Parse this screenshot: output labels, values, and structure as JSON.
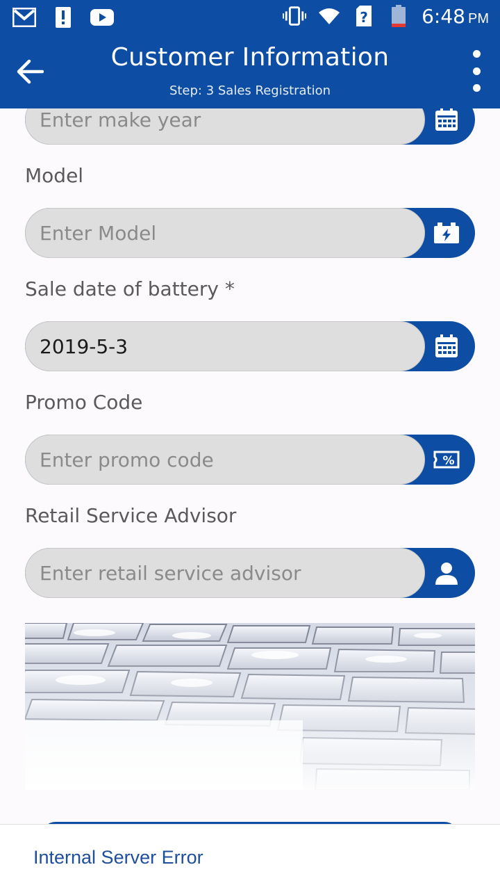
{
  "status_bar": {
    "time": "6:48",
    "ampm": "PM",
    "left_icons": [
      "gmail-icon",
      "alert-icon",
      "youtube-icon"
    ],
    "right_icons": [
      "vibrate-icon",
      "wifi-icon",
      "no-sim-icon",
      "battery-low-icon"
    ]
  },
  "app_bar": {
    "title": "Customer Information",
    "subtitle": "Step: 3 Sales Registration",
    "back_icon": "arrow-left-icon",
    "menu_icon": "more-vert-icon"
  },
  "form": {
    "make_year": {
      "placeholder": "Enter make year",
      "icon": "calendar-icon"
    },
    "model": {
      "label": "Model",
      "placeholder": "Enter Model",
      "icon": "battery-charge-icon"
    },
    "sale_date": {
      "label": "Sale date of battery *",
      "value": "2019-5-3",
      "icon": "calendar-icon"
    },
    "promo_code": {
      "label": "Promo Code",
      "placeholder": "Enter promo code",
      "icon": "discount-ticket-icon"
    },
    "service_advisor": {
      "label": "Retail Service Advisor",
      "placeholder": "Enter retail service advisor",
      "icon": "person-icon"
    }
  },
  "snackbar": {
    "message": "Internal Server Error"
  },
  "colors": {
    "primary": "#0d4da3",
    "field_bg": "#dedede",
    "label": "#5a5a5a",
    "snack_text": "#1f4f9c"
  }
}
